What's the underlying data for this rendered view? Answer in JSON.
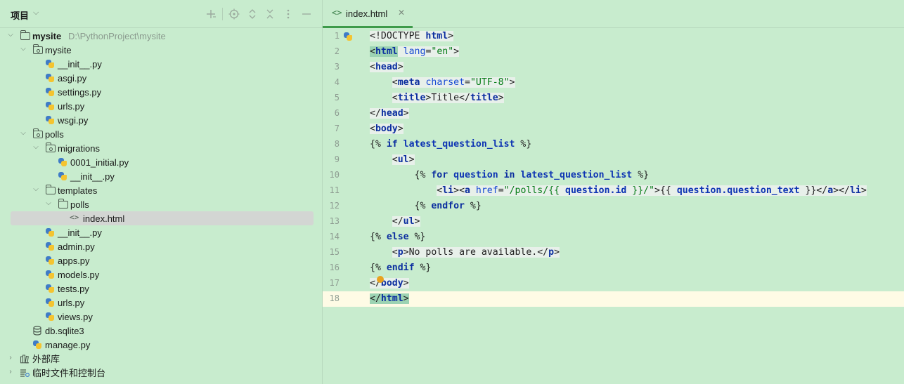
{
  "project_panel": {
    "title": "项目",
    "chevron": "⌵",
    "toolbar_icons": [
      "add-icon",
      "target-icon",
      "expand-collapse-icon",
      "close-icon",
      "more-icon",
      "minimize-icon"
    ],
    "tree": [
      {
        "label": "mysite",
        "path": "D:\\PythonProject\\mysite",
        "type": "folder",
        "bold": true
      },
      {
        "label": "mysite",
        "type": "package"
      },
      {
        "label": "__init__.py",
        "type": "python"
      },
      {
        "label": "asgi.py",
        "type": "python"
      },
      {
        "label": "settings.py",
        "type": "python"
      },
      {
        "label": "urls.py",
        "type": "python"
      },
      {
        "label": "wsgi.py",
        "type": "python"
      },
      {
        "label": "polls",
        "type": "package"
      },
      {
        "label": "migrations",
        "type": "package"
      },
      {
        "label": "0001_initial.py",
        "type": "python"
      },
      {
        "label": "__init__.py",
        "type": "python"
      },
      {
        "label": "templates",
        "type": "folder"
      },
      {
        "label": "polls",
        "type": "folder"
      },
      {
        "label": "index.html",
        "type": "html",
        "selected": true
      },
      {
        "label": "__init__.py",
        "type": "python"
      },
      {
        "label": "admin.py",
        "type": "python"
      },
      {
        "label": "apps.py",
        "type": "python"
      },
      {
        "label": "models.py",
        "type": "python"
      },
      {
        "label": "tests.py",
        "type": "python"
      },
      {
        "label": "urls.py",
        "type": "python"
      },
      {
        "label": "views.py",
        "type": "python"
      },
      {
        "label": "db.sqlite3",
        "type": "database"
      },
      {
        "label": "manage.py",
        "type": "python"
      },
      {
        "label": "外部库",
        "type": "library"
      },
      {
        "label": "临时文件和控制台",
        "type": "scratches"
      }
    ]
  },
  "editor": {
    "tab": {
      "icon": "<>",
      "label": "index.html",
      "close": "✕"
    },
    "line_numbers": [
      "1",
      "2",
      "3",
      "4",
      "5",
      "6",
      "7",
      "8",
      "9",
      "10",
      "11",
      "12",
      "13",
      "14",
      "15",
      "16",
      "17",
      "18"
    ],
    "current_line": 18,
    "lines": [
      "<!DOCTYPE html>",
      "<html lang=\"en\">",
      "<head>",
      "    <meta charset=\"UTF-8\">",
      "    <title>Title</title>",
      "</head>",
      "<body>",
      "{% if latest_question_list %}",
      "    <ul>",
      "        {% for question in latest_question_list %}",
      "            <li><a href=\"/polls/{{ question.id }}/\">{{ question.question_text }}</a></li>",
      "        {% endfor %}",
      "    </ul>",
      "{% else %}",
      "    <p>No polls are available.</p>",
      "{% endif %}",
      "</body>",
      "</html>"
    ]
  },
  "colors": {
    "background": "#c8ecce",
    "current_line": "#fefbe5",
    "selection": "#d3d6d3",
    "tab_underline": "#3e9a4a",
    "keyword": "#0b2e9f",
    "string": "#067d17",
    "warning": "#e8a21f"
  }
}
